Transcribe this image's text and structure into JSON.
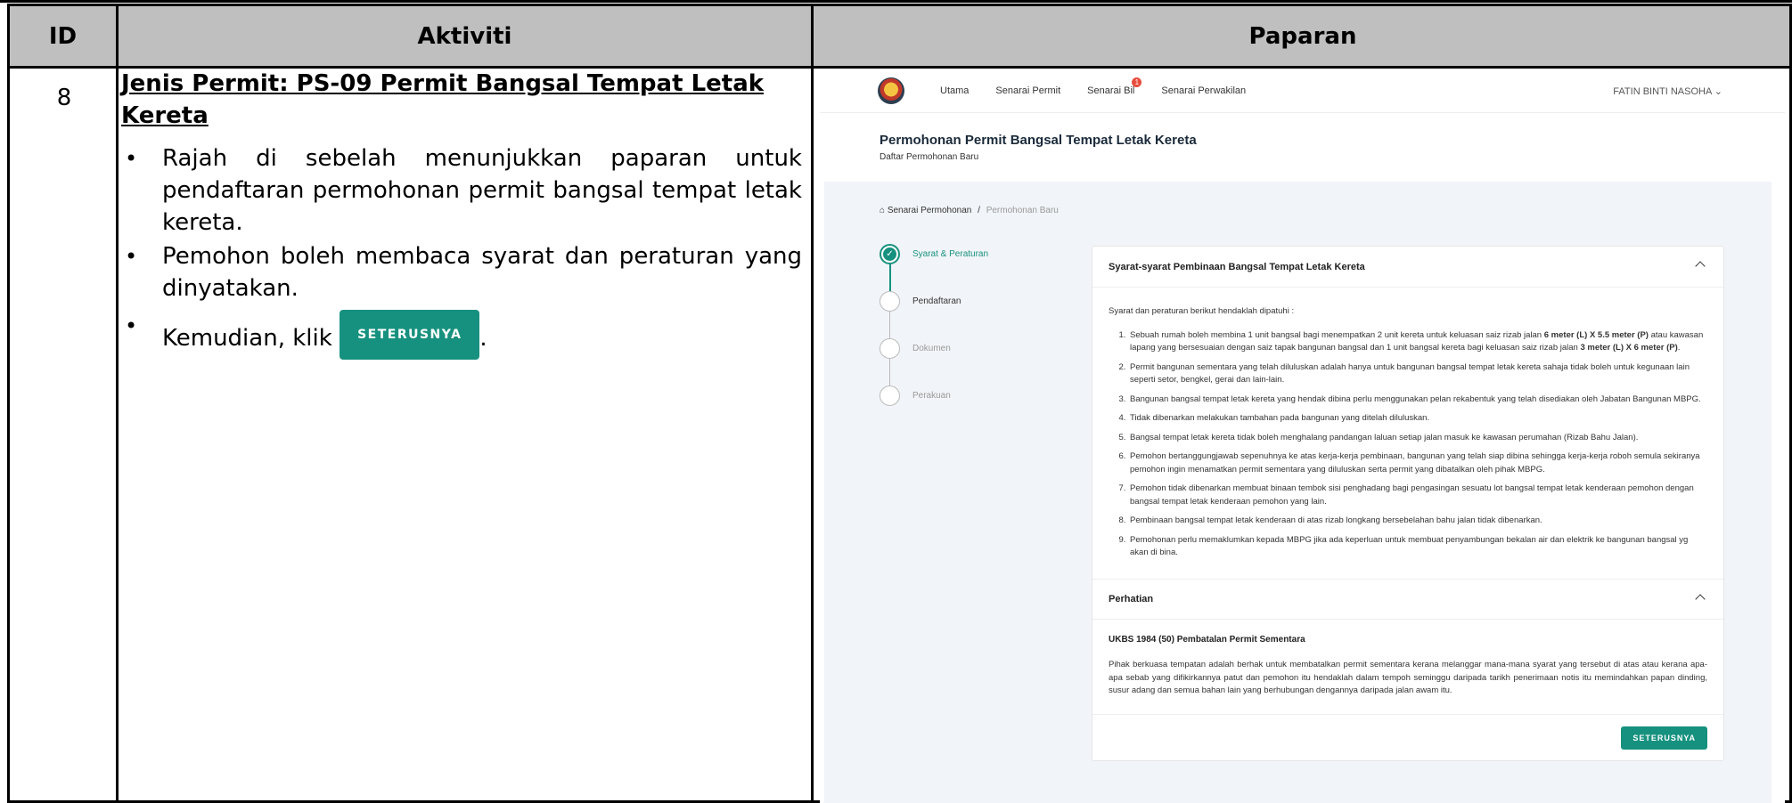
{
  "table": {
    "headers": {
      "id": "ID",
      "activity": "Aktiviti",
      "display": "Paparan"
    },
    "row": {
      "id": "8",
      "title": "Jenis Permit: PS-09 Permit Bangsal Tempat Letak Kereta",
      "bullets": [
        "Rajah di sebelah menunjukkan paparan untuk pendaftaran permohonan permit bangsal tempat letak kereta.",
        "Pemohon boleh membaca syarat dan peraturan yang dinyatakan."
      ],
      "click_prefix": "Kemudian, klik",
      "click_button": "SETERUSNYA",
      "click_suffix": "."
    }
  },
  "app": {
    "nav": {
      "items": [
        "Utama",
        "Senarai Permit",
        "Senarai Bil",
        "Senarai Perwakilan"
      ],
      "bil_badge": "1",
      "user": "FATIN BINTI NASOHA"
    },
    "page_title": "Permohonan Permit Bangsal Tempat Letak Kereta",
    "page_subtitle": "Daftar Permohonan Baru",
    "breadcrumb": {
      "home": "Senarai Permohonan",
      "sep": "/",
      "current": "Permohonan Baru"
    },
    "steps": [
      "Syarat & Peraturan",
      "Pendaftaran",
      "Dokumen",
      "Perakuan"
    ],
    "active_step": 0,
    "card": {
      "title": "Syarat-syarat Pembinaan Bangsal Tempat Letak Kereta",
      "intro": "Syarat dan peraturan berikut hendaklah dipatuhi :",
      "rule1_a": "Sebuah rumah boleh membina 1 unit bangsal bagi menempatkan 2 unit kereta untuk keluasan saiz rizab jalan ",
      "rule1_b1": "6 meter (L) X 5.5 meter (P)",
      "rule1_c": " atau kawasan lapang yang bersesuaian dengan saiz tapak bangunan bangsal dan 1 unit bangsal kereta bagi keluasan saiz rizab jalan ",
      "rule1_b2": "3 meter (L) X 6 meter (P)",
      "rule1_d": ".",
      "rules": [
        "Permit bangunan sementara yang telah diluluskan adalah hanya untuk bangunan bangsal tempat letak kereta sahaja tidak boleh untuk kegunaan lain seperti setor, bengkel, gerai dan lain-lain.",
        "Bangunan bangsal tempat letak kereta yang hendak dibina perlu menggunakan pelan rekabentuk yang telah disediakan oleh Jabatan Bangunan MBPG.",
        "Tidak dibenarkan melakukan tambahan pada bangunan yang ditelah diluluskan.",
        "Bangsal tempat letak kereta tidak boleh menghalang pandangan laluan setiap jalan masuk ke kawasan perumahan (Rizab Bahu Jalan).",
        "Pemohon bertanggungjawab sepenuhnya ke atas kerja-kerja pembinaan, bangunan yang telah siap dibina sehingga kerja-kerja roboh semula sekiranya pemohon ingin menamatkan permit sementara yang diluluskan serta permit yang dibatalkan oleh pihak MBPG.",
        "Pemohon tidak dibenarkan membuat binaan tembok sisi penghadang bagi pengasingan sesuatu lot bangsal tempat letak kenderaan pemohon dengan bangsal tempat letak kenderaan pemohon yang lain.",
        "Pembinaan bangsal tempat letak kenderaan di atas rizab longkang bersebelahan bahu jalan tidak dibenarkan.",
        "Pemohonan perlu memaklumkan kepada MBPG jika ada keperluan untuk membuat penyambungan bekalan air dan elektrik ke bangunan bangsal yg akan di bina."
      ]
    },
    "notice": {
      "title": "Perhatian",
      "heading": "UKBS 1984 (50) Pembatalan Permit Sementara",
      "text": "Pihak berkuasa tempatan adalah berhak untuk membatalkan permit sementara kerana melanggar mana-mana syarat yang tersebut di atas atau kerana apa-apa sebab yang difikirkannya patut dan pemohon itu hendaklah dalam tempoh seminggu daripada tarikh penerimaan notis itu memindahkan papan dinding, susur adang dan semua bahan lain yang berhubungan dengannya daripada jalan awam itu."
    },
    "next_button": "SETERUSNYA",
    "colors": {
      "accent": "#17917f",
      "header_gray": "#bfbfbf",
      "panel_bg": "#f1f4f8"
    }
  }
}
